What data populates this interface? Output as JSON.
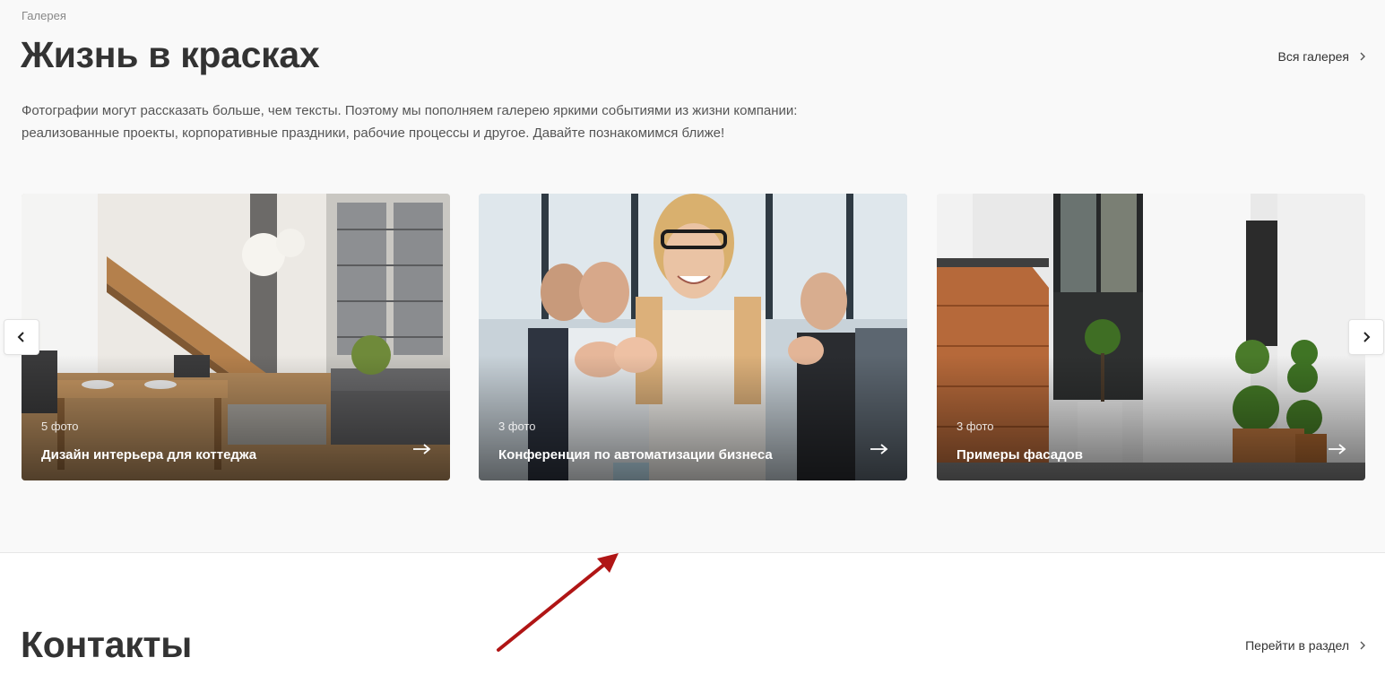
{
  "gallery": {
    "eyebrow": "Галерея",
    "title": "Жизнь в красках",
    "all_link": "Вся галерея",
    "intro_line1": "Фотографии могут рассказать больше, чем тексты. Поэтому мы пополняем галерею яркими событиями из жизни компании:",
    "intro_line2": "реализованные проекты, корпоративные праздники, рабочие процессы и другое. Давайте познакомимся ближе!",
    "cards": [
      {
        "count": "5 фото",
        "caption": "Дизайн интерьера для коттеджа"
      },
      {
        "count": "3 фото",
        "caption": "Конференция по автоматизации бизнеса"
      },
      {
        "count": "3 фото",
        "caption": "Примеры фасадов"
      }
    ]
  },
  "contacts": {
    "title": "Контакты",
    "section_link": "Перейти в раздел"
  },
  "colors": {
    "annotation_arrow": "#b01515",
    "section_bg": "#f9f9f9"
  },
  "icons": {
    "prev": "chevron-left-icon",
    "next": "chevron-right-icon",
    "card_arrow": "arrow-right-icon"
  }
}
